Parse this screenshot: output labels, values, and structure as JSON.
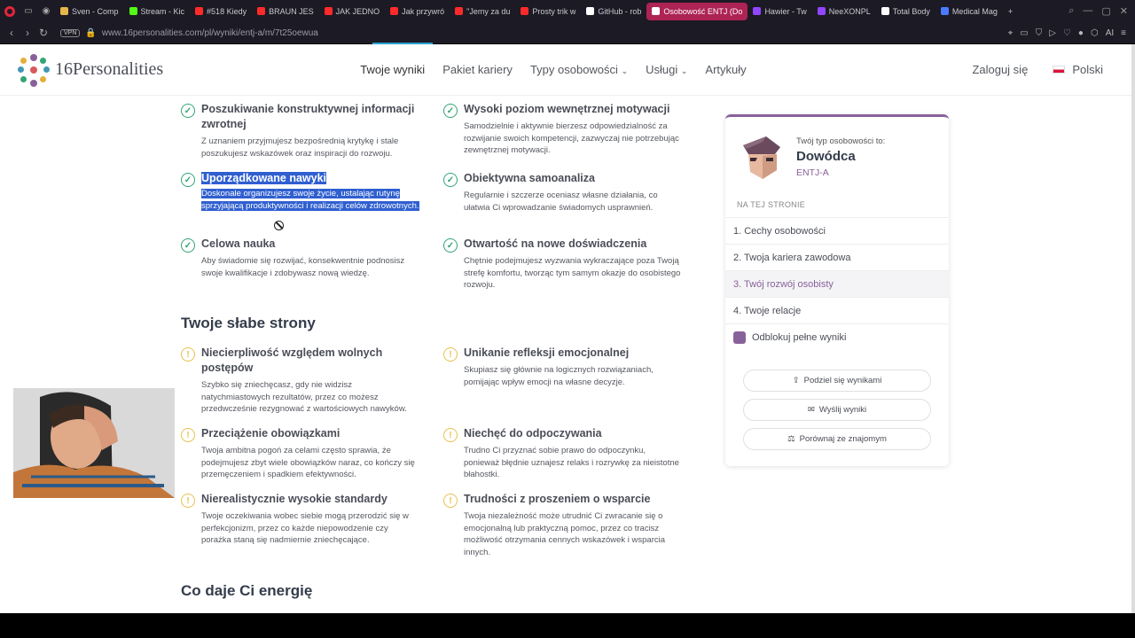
{
  "browser": {
    "tabs": [
      {
        "label": "Sven - Comp",
        "color": "#e8b54a"
      },
      {
        "label": "Stream - Kic",
        "color": "#53fc18"
      },
      {
        "label": "#518 Kiedy",
        "color": "#ff2a2a"
      },
      {
        "label": "BRAUN JES",
        "color": "#ff2a2a"
      },
      {
        "label": "JAK JEDNO",
        "color": "#ff2a2a"
      },
      {
        "label": "Jak przywró",
        "color": "#ff2a2a"
      },
      {
        "label": "\"Jemy za du",
        "color": "#ff2a2a"
      },
      {
        "label": "Prosty trik w",
        "color": "#ff2a2a"
      },
      {
        "label": "GitHub - rob",
        "color": "#ffffff"
      },
      {
        "label": "Osobowość ENTJ (Do",
        "color": "#ffffff",
        "active": true
      },
      {
        "label": "Hawier - Tw",
        "color": "#9146ff"
      },
      {
        "label": "NeeXONPL",
        "color": "#9146ff"
      },
      {
        "label": "Total Body",
        "color": "#ffffff"
      },
      {
        "label": "Medical Mag",
        "color": "#4a7bff"
      }
    ],
    "vpn": "VPN",
    "url": "www.16personalities.com/pl/wyniki/entj-a/m/7t25oewua"
  },
  "header": {
    "logo": "16Personalities",
    "nav": [
      "Twoje wyniki",
      "Pakiet kariery",
      "Typy osobowości",
      "Usługi",
      "Artykuły"
    ],
    "login": "Zaloguj się",
    "language": "Polski"
  },
  "strengths": [
    {
      "title": "Poszukiwanie konstruktywnej informacji zwrotnej",
      "text": "Z uznaniem przyjmujesz bezpośrednią krytykę i stale poszukujesz wskazówek oraz inspiracji do rozwoju."
    },
    {
      "title": "Wysoki poziom wewnętrznej motywacji",
      "text": "Samodzielnie i aktywnie bierzesz odpowiedzialność za rozwijanie swoich kompetencji, zazwyczaj nie potrzebując zewnętrznej motywacji."
    },
    {
      "title": "Uporządkowane nawyki",
      "text": "Doskonale organizujesz swoje życie, ustalając rutynę sprzyjającą produktywności i realizacji celów zdrowotnych."
    },
    {
      "title": "Obiektywna samoanaliza",
      "text": "Regularnie i szczerze oceniasz własne działania, co ułatwia Ci wprowadzanie świadomych usprawnień."
    },
    {
      "title": "Celowa nauka",
      "text": "Aby świadomie się rozwijać, konsekwentnie podnosisz swoje kwalifikacje i zdobywasz nową wiedzę."
    },
    {
      "title": "Otwartość na nowe doświadczenia",
      "text": "Chętnie podejmujesz wyzwania wykraczające poza Twoją strefę komfortu, tworząc tym samym okazje do osobistego rozwoju."
    }
  ],
  "weaknesses_title": "Twoje słabe strony",
  "weaknesses": [
    {
      "title": "Niecierpliwość względem wolnych postępów",
      "text": "Szybko się zniechęcasz, gdy nie widzisz natychmiastowych rezultatów, przez co możesz przedwcześnie rezygnować z wartościowych nawyków."
    },
    {
      "title": "Unikanie refleksji emocjonalnej",
      "text": "Skupiasz się głównie na logicznych rozwiązaniach, pomijając wpływ emocji na własne decyzje."
    },
    {
      "title": "Przeciążenie obowiązkami",
      "text": "Twoja ambitna pogoń za celami często sprawia, że podejmujesz zbyt wiele obowiązków naraz, co kończy się przemęczeniem i spadkiem efektywności."
    },
    {
      "title": "Niechęć do odpoczywania",
      "text": "Trudno Ci przyznać sobie prawo do odpoczynku, ponieważ błędnie uznajesz relaks i rozrywkę za nieistotne błahostki."
    },
    {
      "title": "Nierealistycznie wysokie standardy",
      "text": "Twoje oczekiwania wobec siebie mogą przerodzić się w perfekcjonizm, przez co każde niepowodzenie czy porażka staną się nadmiernie zniechęcające."
    },
    {
      "title": "Trudności z proszeniem o wsparcie",
      "text": "Twoja niezależność może utrudnić Ci zwracanie się o emocjonalną lub praktyczną pomoc, przez co tracisz możliwość otrzymania cennych wskazówek i wsparcia innych."
    }
  ],
  "energy_title": "Co daje Ci energię",
  "panel": {
    "label": "Twój typ osobowości to:",
    "type_name": "Dowódca",
    "type_code": "ENTJ-A",
    "on_page": "NA TEJ STRONIE",
    "toc": [
      "1. Cechy osobowości",
      "2. Twoja kariera zawodowa",
      "3. Twój rozwój osobisty",
      "4. Twoje relacje"
    ],
    "unlock": "Odblokuj pełne wyniki",
    "buttons": [
      "Podziel się wynikami",
      "Wyślij wyniki",
      "Porównaj ze znajomym"
    ]
  }
}
